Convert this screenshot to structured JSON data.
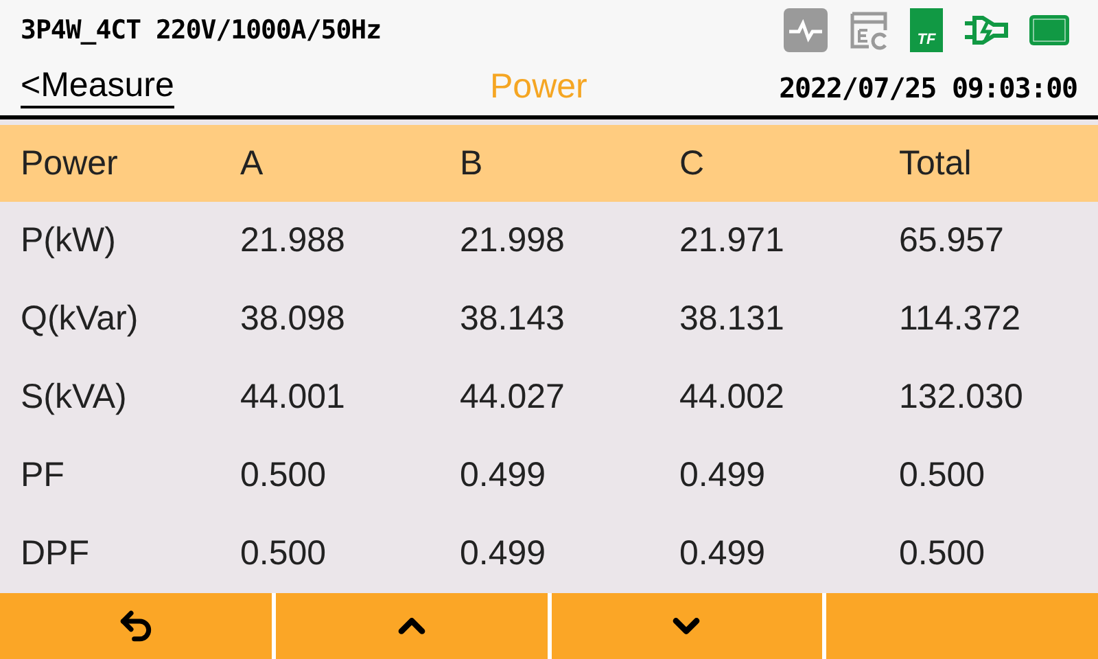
{
  "status_bar": {
    "config": "3P4W_4CT 220V/1000A/50Hz",
    "sd_card_label": "TF"
  },
  "nav": {
    "back": "<Measure",
    "title": "Power",
    "datetime": "2022/07/25 09:03:00"
  },
  "table": {
    "columns": [
      "Power",
      "A",
      "B",
      "C",
      "Total"
    ],
    "rows": [
      [
        "P(kW)",
        "21.988",
        "21.998",
        "21.971",
        "65.957"
      ],
      [
        "Q(kVar)",
        "38.098",
        "38.143",
        "38.131",
        "114.372"
      ],
      [
        "S(kVA)",
        "44.001",
        "44.027",
        "44.002",
        "132.030"
      ],
      [
        "PF",
        "0.500",
        "0.499",
        "0.499",
        "0.500"
      ],
      [
        "DPF",
        "0.500",
        "0.499",
        "0.499",
        "0.500"
      ]
    ]
  },
  "footer": [
    {
      "kind": "back"
    },
    {
      "kind": "up"
    },
    {
      "kind": "down"
    },
    {
      "kind": "empty"
    }
  ]
}
